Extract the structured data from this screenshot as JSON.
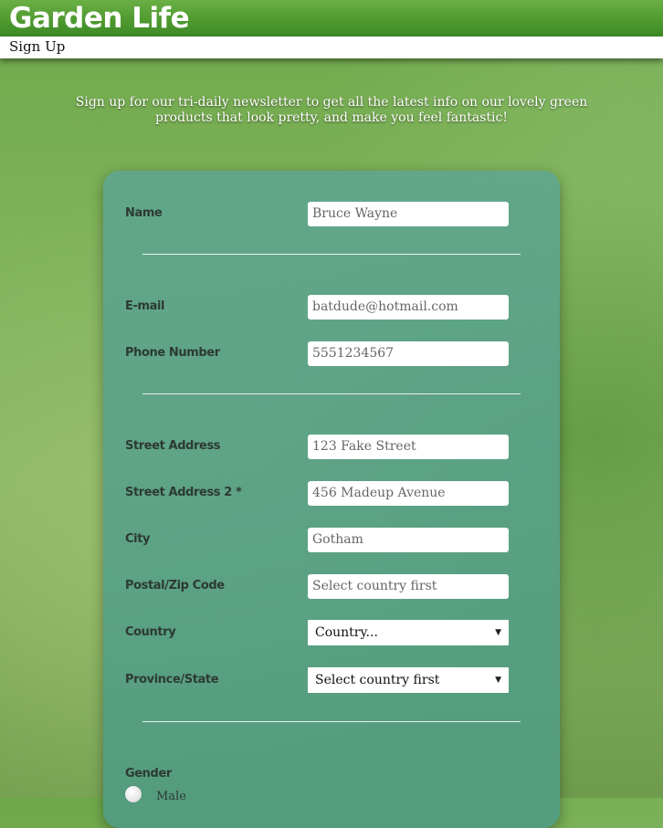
{
  "header": {
    "title": "Garden Life"
  },
  "nav": {
    "signup": "Sign Up"
  },
  "intro": {
    "line1": "Sign up for our tri-daily newsletter to get all the latest info on our lovely green",
    "line2": "products that look pretty, and make you feel fantastic!"
  },
  "form": {
    "name": {
      "label": "Name",
      "value": "Bruce Wayne"
    },
    "email": {
      "label": "E-mail",
      "value": "batdude@hotmail.com"
    },
    "phone": {
      "label": "Phone Number",
      "value": "5551234567"
    },
    "street1": {
      "label": "Street Address",
      "value": "123 Fake Street"
    },
    "street2": {
      "label": "Street Address 2 *",
      "value": "456 Madeup Avenue"
    },
    "city": {
      "label": "City",
      "value": "Gotham"
    },
    "postal": {
      "label": "Postal/Zip Code",
      "placeholder": "Select country first"
    },
    "country": {
      "label": "Country",
      "selected": "Country..."
    },
    "province": {
      "label": "Province/State",
      "selected": "Select country first"
    },
    "gender": {
      "label": "Gender",
      "option_male": "Male"
    }
  },
  "icons": {
    "dropdown": "chevron-down-icon"
  },
  "colors": {
    "header_green": "#4f9a30",
    "card_teal": "#5fa591",
    "label_text": "#2c3a34"
  }
}
